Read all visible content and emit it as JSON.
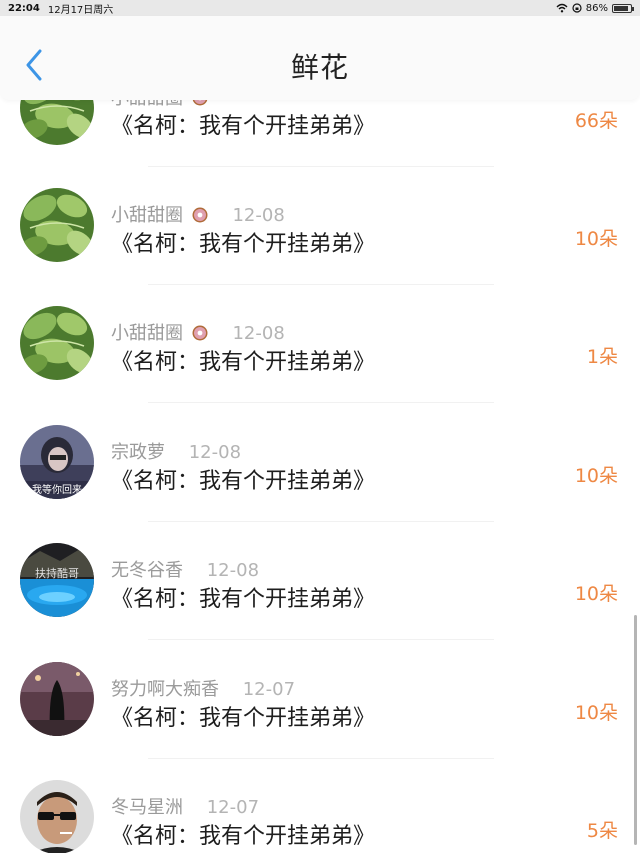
{
  "status_bar": {
    "time": "22:04",
    "date": "12月17日周六",
    "battery": "86%",
    "battery_level": 0.86
  },
  "header": {
    "title": "鲜花",
    "back_icon": "chevron-left-icon"
  },
  "rows": [
    {
      "user": "小甜甜圈",
      "date": "",
      "book": "《名柯：我有个开挂弟弟》",
      "flowers": "66朵",
      "avatar": "leaves",
      "has_donut": true
    },
    {
      "user": "小甜甜圈",
      "date": "12-08",
      "book": "《名柯：我有个开挂弟弟》",
      "flowers": "10朵",
      "avatar": "leaves",
      "has_donut": true
    },
    {
      "user": "小甜甜圈",
      "date": "12-08",
      "book": "《名柯：我有个开挂弟弟》",
      "flowers": "1朵",
      "avatar": "leaves",
      "has_donut": true
    },
    {
      "user": "宗政萝",
      "date": "12-08",
      "book": "《名柯：我有个开挂弟弟》",
      "flowers": "10朵",
      "avatar": "girl-purple",
      "avatar_text": "我等你回来",
      "has_donut": false
    },
    {
      "user": "无冬谷香",
      "date": "12-08",
      "book": "《名柯：我有个开挂弟弟》",
      "flowers": "10朵",
      "avatar": "blue-pool",
      "avatar_text": "扶持酷哥",
      "has_donut": false
    },
    {
      "user": "努力啊大痴香",
      "date": "12-07",
      "book": "《名柯：我有个开挂弟弟》",
      "flowers": "10朵",
      "avatar": "dark-girl",
      "has_donut": false
    },
    {
      "user": "冬马星洲",
      "date": "12-07",
      "book": "《名柯：我有个开挂弟弟》",
      "flowers": "5朵",
      "avatar": "man-sunglasses",
      "has_donut": false
    }
  ],
  "colors": {
    "accent": "#3d95e6",
    "flowers": "#ee8844",
    "username": "#9a9a9a"
  }
}
